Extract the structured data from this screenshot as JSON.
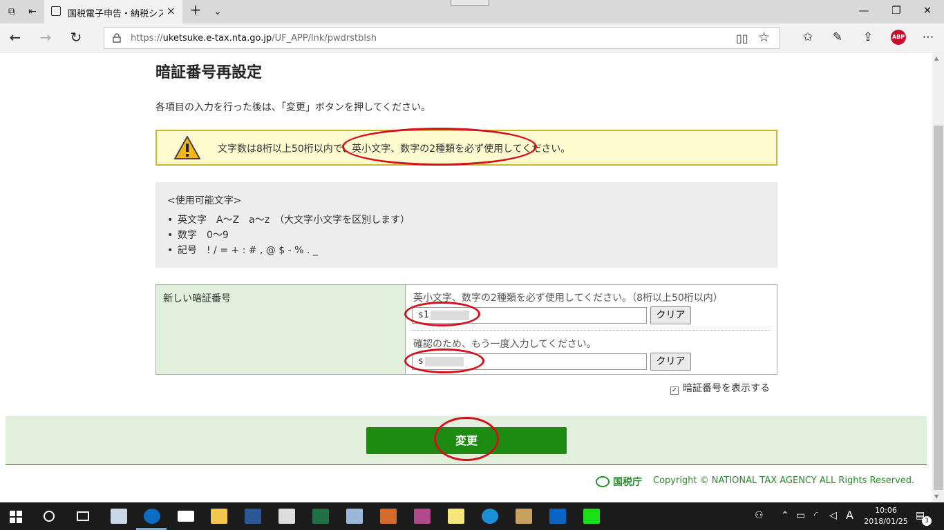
{
  "browser": {
    "tab_title": "国税電子申告・納税シス",
    "url_prefix": "https://",
    "url_host": "uketsuke.e-tax.nta.go.jp",
    "url_path": "/UF_APP/lnk/pwdrstblsh",
    "extension_label": "ABP"
  },
  "page": {
    "heading": "暗証番号再設定",
    "instruction": "各項目の入力を行った後は、「変更」ボタンを押してください。",
    "warning": "文字数は8桁以上50桁以内で、英小文字、数字の2種類を必ず使用してください。",
    "allowed_chars": {
      "title": "<使用可能文字>",
      "items": [
        "英文字　A～Z　a～z　（大文字小文字を区別します）",
        "数字　0～9",
        "記号　! / = + : # , @ $ - % . _"
      ]
    },
    "form": {
      "label": "新しい暗証番号",
      "new_hint": "英小文字、数字の2種類を必ず使用してください。（8桁以上50桁以内）",
      "new_value": "s1",
      "confirm_hint": "確認のため、もう一度入力してください。",
      "confirm_value": "s",
      "clear_label": "クリア",
      "show_password_label": "暗証番号を表示する",
      "show_password_checked": true
    },
    "submit_label": "変更",
    "footer_logo": "国税庁",
    "copyright": "Copyright © NATIONAL TAX AGENCY ALL Rights Reserved."
  },
  "taskbar": {
    "time": "10:06",
    "date": "2018/01/25",
    "ime": "A",
    "notification_count": "3"
  },
  "colors": {
    "accent_green": "#1d8a12",
    "annotation_red": "#d3101c"
  }
}
